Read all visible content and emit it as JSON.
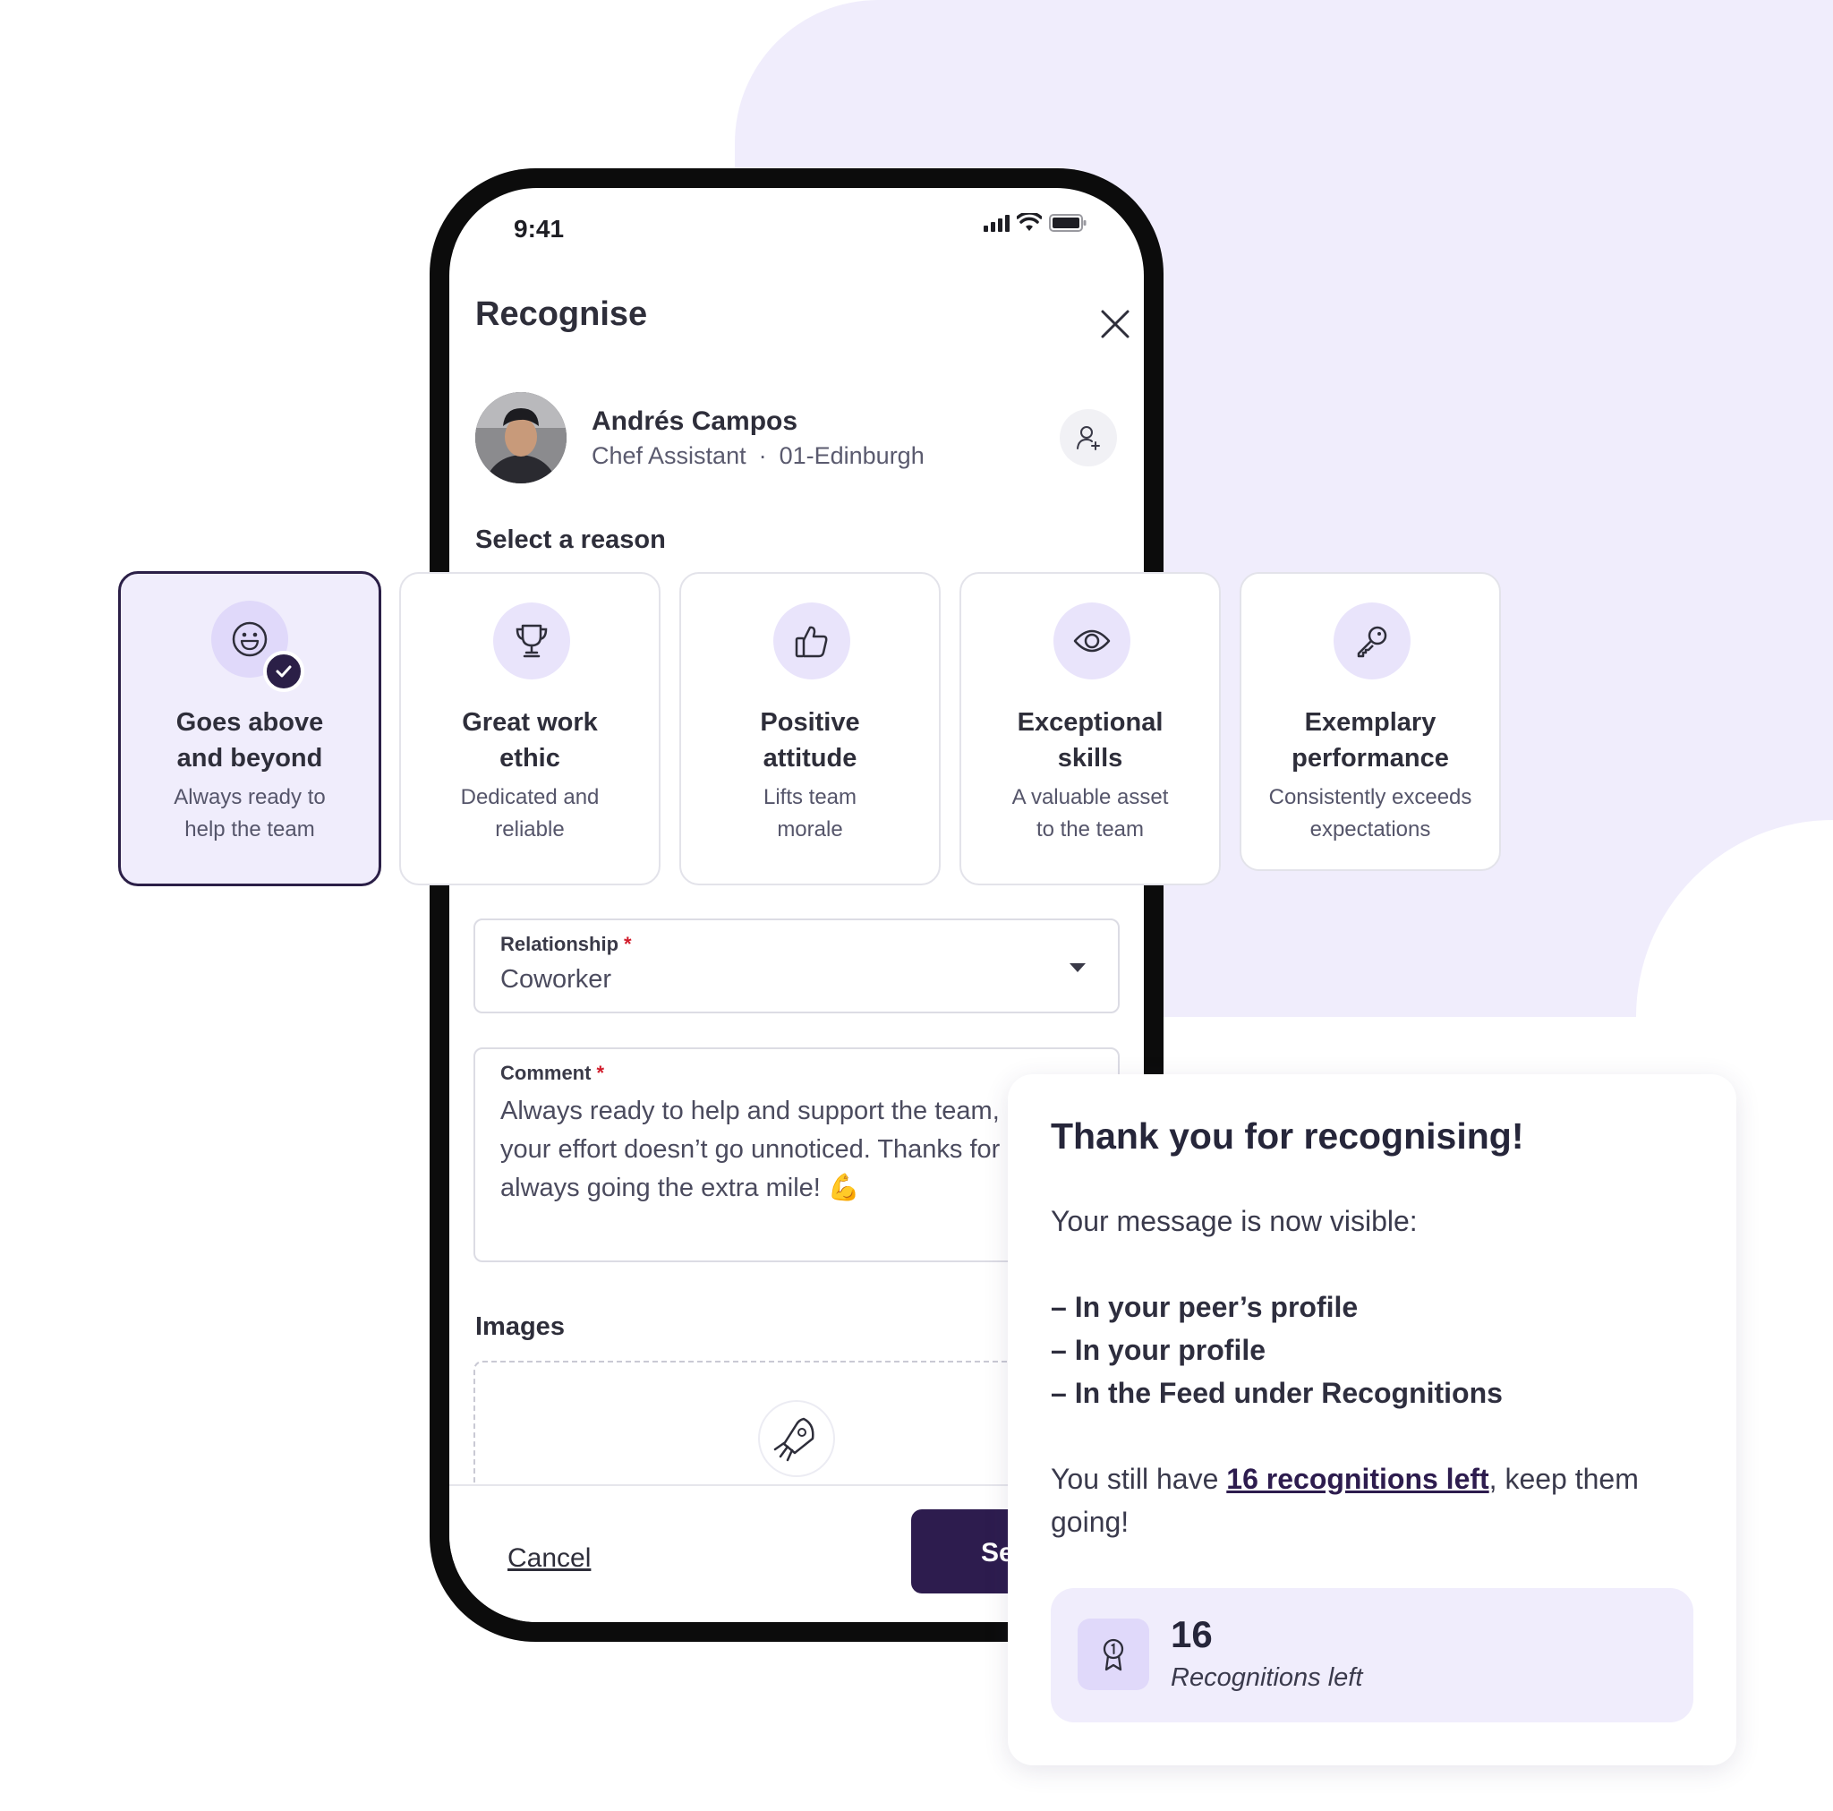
{
  "status_bar": {
    "time": "9:41"
  },
  "sheet": {
    "title": "Recognise"
  },
  "person": {
    "name": "Andrés Campos",
    "role": "Chef Assistant",
    "separator": "·",
    "location": "01-Edinburgh"
  },
  "reason_section": {
    "label": "Select a reason"
  },
  "reasons": [
    {
      "title_line1": "Goes above",
      "title_line2": "and beyond",
      "sub_line1": "Always ready to",
      "sub_line2": "help the team",
      "icon": "smile-icon",
      "selected": true
    },
    {
      "title_line1": "Great work",
      "title_line2": "ethic",
      "sub_line1": "Dedicated and",
      "sub_line2": "reliable",
      "icon": "trophy-icon",
      "selected": false
    },
    {
      "title_line1": "Positive",
      "title_line2": "attitude",
      "sub_line1": "Lifts team",
      "sub_line2": "morale",
      "icon": "thumbs-up-icon",
      "selected": false
    },
    {
      "title_line1": "Exceptional",
      "title_line2": "skills",
      "sub_line1": "A valuable asset",
      "sub_line2": "to the team",
      "icon": "eye-icon",
      "selected": false
    },
    {
      "title_line1": "Exemplary",
      "title_line2": "performance",
      "sub_line1": "Consistently exceeds",
      "sub_line2": "expectations",
      "icon": "key-icon",
      "selected": false
    }
  ],
  "relationship": {
    "label": "Relationship",
    "required_mark": "*",
    "value": "Coworker"
  },
  "comment": {
    "label": "Comment",
    "required_mark": "*",
    "value": "Always ready to help and support the team, your effort doesn’t go unnoticed. Thanks for always going the extra mile! 💪"
  },
  "images": {
    "label": "Images"
  },
  "footer": {
    "cancel_label": "Cancel",
    "send_label": "Se"
  },
  "thank_you": {
    "title": "Thank you for recognising!",
    "intro": "Your message is now visible:",
    "items": [
      "– In your peer’s profile",
      "– In your profile",
      "– In the Feed under Recognitions"
    ],
    "remaining_prefix": "You still have ",
    "remaining_link": "16 recognitions left",
    "remaining_suffix": ", keep them going!",
    "counter_value": "16",
    "counter_label": "Recognitions left"
  },
  "colors": {
    "accent_dark": "#2d1c4e",
    "lavender": "#f0edfc",
    "required": "#d11b2a"
  }
}
